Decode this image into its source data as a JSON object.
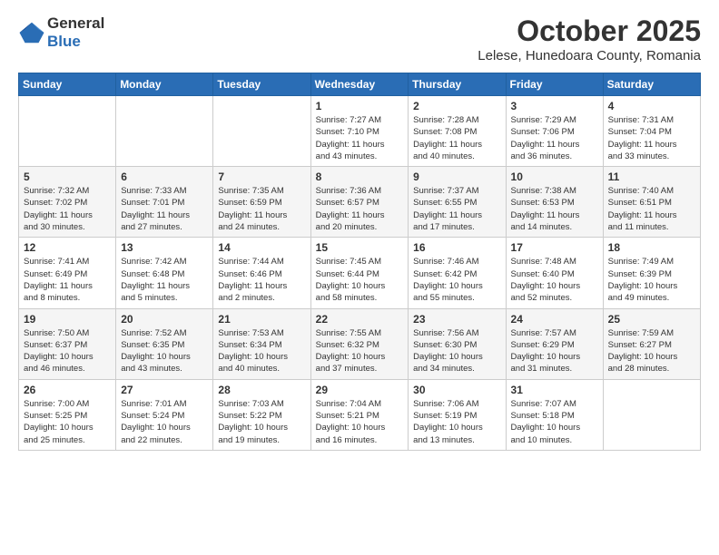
{
  "header": {
    "logo_general": "General",
    "logo_blue": "Blue",
    "month_title": "October 2025",
    "location": "Lelese, Hunedoara County, Romania"
  },
  "weekdays": [
    "Sunday",
    "Monday",
    "Tuesday",
    "Wednesday",
    "Thursday",
    "Friday",
    "Saturday"
  ],
  "weeks": [
    [
      {
        "day": null,
        "info": null
      },
      {
        "day": null,
        "info": null
      },
      {
        "day": null,
        "info": null
      },
      {
        "day": "1",
        "info": "Sunrise: 7:27 AM\nSunset: 7:10 PM\nDaylight: 11 hours\nand 43 minutes."
      },
      {
        "day": "2",
        "info": "Sunrise: 7:28 AM\nSunset: 7:08 PM\nDaylight: 11 hours\nand 40 minutes."
      },
      {
        "day": "3",
        "info": "Sunrise: 7:29 AM\nSunset: 7:06 PM\nDaylight: 11 hours\nand 36 minutes."
      },
      {
        "day": "4",
        "info": "Sunrise: 7:31 AM\nSunset: 7:04 PM\nDaylight: 11 hours\nand 33 minutes."
      }
    ],
    [
      {
        "day": "5",
        "info": "Sunrise: 7:32 AM\nSunset: 7:02 PM\nDaylight: 11 hours\nand 30 minutes."
      },
      {
        "day": "6",
        "info": "Sunrise: 7:33 AM\nSunset: 7:01 PM\nDaylight: 11 hours\nand 27 minutes."
      },
      {
        "day": "7",
        "info": "Sunrise: 7:35 AM\nSunset: 6:59 PM\nDaylight: 11 hours\nand 24 minutes."
      },
      {
        "day": "8",
        "info": "Sunrise: 7:36 AM\nSunset: 6:57 PM\nDaylight: 11 hours\nand 20 minutes."
      },
      {
        "day": "9",
        "info": "Sunrise: 7:37 AM\nSunset: 6:55 PM\nDaylight: 11 hours\nand 17 minutes."
      },
      {
        "day": "10",
        "info": "Sunrise: 7:38 AM\nSunset: 6:53 PM\nDaylight: 11 hours\nand 14 minutes."
      },
      {
        "day": "11",
        "info": "Sunrise: 7:40 AM\nSunset: 6:51 PM\nDaylight: 11 hours\nand 11 minutes."
      }
    ],
    [
      {
        "day": "12",
        "info": "Sunrise: 7:41 AM\nSunset: 6:49 PM\nDaylight: 11 hours\nand 8 minutes."
      },
      {
        "day": "13",
        "info": "Sunrise: 7:42 AM\nSunset: 6:48 PM\nDaylight: 11 hours\nand 5 minutes."
      },
      {
        "day": "14",
        "info": "Sunrise: 7:44 AM\nSunset: 6:46 PM\nDaylight: 11 hours\nand 2 minutes."
      },
      {
        "day": "15",
        "info": "Sunrise: 7:45 AM\nSunset: 6:44 PM\nDaylight: 10 hours\nand 58 minutes."
      },
      {
        "day": "16",
        "info": "Sunrise: 7:46 AM\nSunset: 6:42 PM\nDaylight: 10 hours\nand 55 minutes."
      },
      {
        "day": "17",
        "info": "Sunrise: 7:48 AM\nSunset: 6:40 PM\nDaylight: 10 hours\nand 52 minutes."
      },
      {
        "day": "18",
        "info": "Sunrise: 7:49 AM\nSunset: 6:39 PM\nDaylight: 10 hours\nand 49 minutes."
      }
    ],
    [
      {
        "day": "19",
        "info": "Sunrise: 7:50 AM\nSunset: 6:37 PM\nDaylight: 10 hours\nand 46 minutes."
      },
      {
        "day": "20",
        "info": "Sunrise: 7:52 AM\nSunset: 6:35 PM\nDaylight: 10 hours\nand 43 minutes."
      },
      {
        "day": "21",
        "info": "Sunrise: 7:53 AM\nSunset: 6:34 PM\nDaylight: 10 hours\nand 40 minutes."
      },
      {
        "day": "22",
        "info": "Sunrise: 7:55 AM\nSunset: 6:32 PM\nDaylight: 10 hours\nand 37 minutes."
      },
      {
        "day": "23",
        "info": "Sunrise: 7:56 AM\nSunset: 6:30 PM\nDaylight: 10 hours\nand 34 minutes."
      },
      {
        "day": "24",
        "info": "Sunrise: 7:57 AM\nSunset: 6:29 PM\nDaylight: 10 hours\nand 31 minutes."
      },
      {
        "day": "25",
        "info": "Sunrise: 7:59 AM\nSunset: 6:27 PM\nDaylight: 10 hours\nand 28 minutes."
      }
    ],
    [
      {
        "day": "26",
        "info": "Sunrise: 7:00 AM\nSunset: 5:25 PM\nDaylight: 10 hours\nand 25 minutes."
      },
      {
        "day": "27",
        "info": "Sunrise: 7:01 AM\nSunset: 5:24 PM\nDaylight: 10 hours\nand 22 minutes."
      },
      {
        "day": "28",
        "info": "Sunrise: 7:03 AM\nSunset: 5:22 PM\nDaylight: 10 hours\nand 19 minutes."
      },
      {
        "day": "29",
        "info": "Sunrise: 7:04 AM\nSunset: 5:21 PM\nDaylight: 10 hours\nand 16 minutes."
      },
      {
        "day": "30",
        "info": "Sunrise: 7:06 AM\nSunset: 5:19 PM\nDaylight: 10 hours\nand 13 minutes."
      },
      {
        "day": "31",
        "info": "Sunrise: 7:07 AM\nSunset: 5:18 PM\nDaylight: 10 hours\nand 10 minutes."
      },
      {
        "day": null,
        "info": null
      }
    ]
  ]
}
